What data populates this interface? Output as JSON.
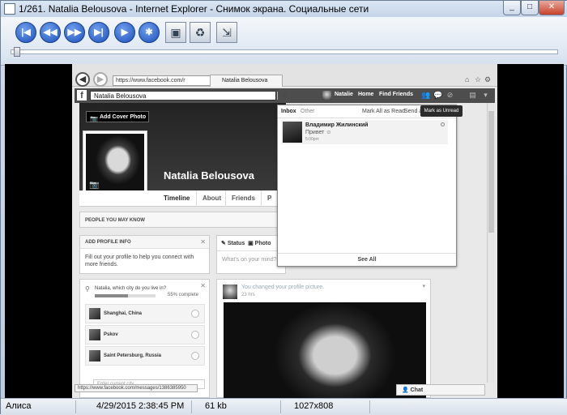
{
  "window": {
    "title": "1/261. Natalia Belousova - Internet Explorer - Снимок экрана. Социальные сети",
    "controls": [
      "_",
      "□",
      "✕"
    ]
  },
  "toolbar": {
    "buttons": [
      {
        "name": "first-icon",
        "glyph": "|◀"
      },
      {
        "name": "prev-icon",
        "glyph": "◀◀"
      },
      {
        "name": "next-icon",
        "glyph": "▶▶"
      },
      {
        "name": "last-icon",
        "glyph": "▶|"
      },
      {
        "name": "play-icon",
        "glyph": "▶"
      },
      {
        "name": "settings-icon",
        "glyph": "✱"
      },
      {
        "name": "save-icon",
        "glyph": "▣"
      },
      {
        "name": "recycle-icon",
        "glyph": "♻"
      },
      {
        "name": "export-icon",
        "glyph": "⇲"
      }
    ],
    "slider_position": 0.0
  },
  "status_bar": {
    "user": "Алиса",
    "datetime": "4/29/2015 2:38:45 PM",
    "size": "61 kb",
    "resolution": "1027x808"
  },
  "browser": {
    "address": "https://www.facebook.com/r",
    "tab_title": "Natalia Belousova",
    "status_url": "https://www.facebook.com/messages/1386385950"
  },
  "facebook": {
    "logo": "f",
    "search_value": "Natalia Belousova",
    "nav": {
      "user": "Natalie",
      "home": "Home",
      "find_friends": "Find Friends"
    },
    "cover_button": "Add Cover Photo",
    "profile_name": "Natalia Belousova",
    "tabs": [
      "Timeline",
      "About",
      "Friends",
      "P"
    ],
    "people_you_may_know": "PEOPLE YOU MAY KNOW",
    "add_profile_info": {
      "title": "ADD PROFILE INFO",
      "body": "Fill out your profile to help you connect with more friends."
    },
    "city_card": {
      "question": "Natalia, which city do you live in?",
      "progress": 0.55,
      "progress_label": "55% complete",
      "cities": [
        "Shanghai, China",
        "Pskov",
        "Saint Petersburg, Russia"
      ],
      "input_placeholder": "Enter current city"
    },
    "composer": {
      "status": "Status",
      "photo": "Photo",
      "placeholder": "What's on your mind?"
    },
    "post": {
      "text": "You changed your profile picture.",
      "time": "23 hrs"
    },
    "inbox": {
      "tab_inbox": "Inbox",
      "tab_other": "Other",
      "mark_all": "Mark All as Read",
      "send": "Send a",
      "message": {
        "name": "Владимир Жилинский",
        "preview": "Привет",
        "time": "5:00pm"
      },
      "see_all": "See All"
    },
    "tooltip": "Mark as Unread",
    "chat": "Chat"
  }
}
